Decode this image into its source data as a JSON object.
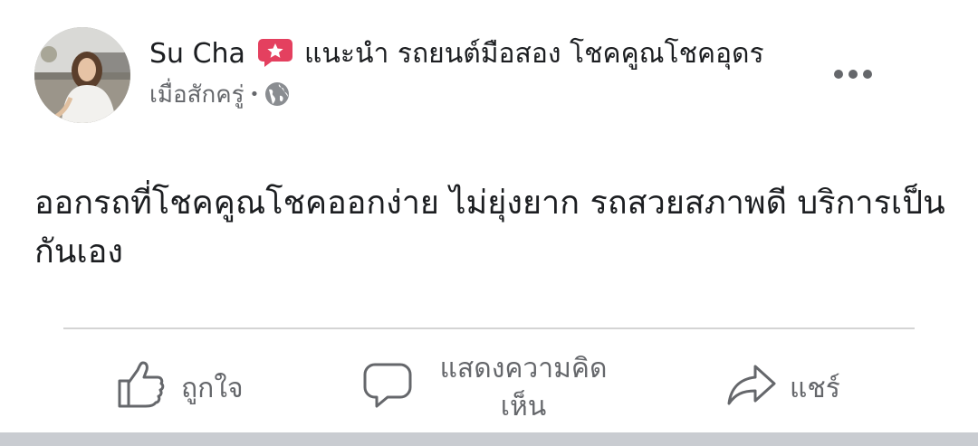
{
  "post": {
    "author": {
      "name": "Su Cha",
      "badge_icon": "star-badge-icon",
      "badge_color": "#e4405f",
      "group_name": "แนะนำ รถยนต์มือสอง โชคคูณโชคอุดร"
    },
    "timestamp": "เมื่อสักครู่",
    "separator": "•",
    "audience_icon": "globe-icon",
    "more_icon": "more-options-icon",
    "body": "ออกรถที่โชคคูณโชคออกง่าย ไม่ยุ่งยาก รถสวยสภาพดี บริการเป็นกันเอง"
  },
  "actions": {
    "like_label": "ถูกใจ",
    "comment_label": "แสดงความคิดเห็น",
    "share_label": "แชร์"
  },
  "colors": {
    "text_primary": "#1c1e21",
    "text_secondary": "#65676b",
    "divider": "#d4d4d4",
    "footer_strip": "#c9ccd1"
  }
}
